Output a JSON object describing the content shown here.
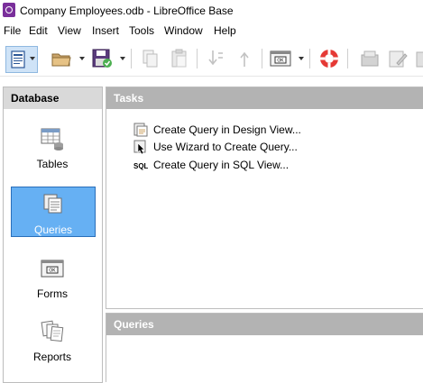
{
  "window": {
    "title": "Company Employees.odb - LibreOffice Base"
  },
  "menu": [
    "File",
    "Edit",
    "View",
    "Insert",
    "Tools",
    "Window",
    "Help"
  ],
  "toolbar": {
    "icons": [
      "new-document-icon",
      "open-folder-icon",
      "save-icon",
      "copy-icon",
      "paste-icon",
      "sort-ascending-icon",
      "sort-descending-icon",
      "form-control-icon",
      "help-lifebuoy-icon",
      "open-object-icon",
      "edit-object-icon",
      "delete-object-icon"
    ]
  },
  "sidebar": {
    "header": "Database",
    "items": [
      {
        "label": "Tables",
        "icon": "tables-icon",
        "selected": false
      },
      {
        "label": "Queries",
        "icon": "queries-icon",
        "selected": true
      },
      {
        "label": "Forms",
        "icon": "forms-icon",
        "selected": false
      },
      {
        "label": "Reports",
        "icon": "reports-icon",
        "selected": false
      }
    ]
  },
  "tasks": {
    "header": "Tasks",
    "items": [
      {
        "label": "Create Query in Design View...",
        "icon": "design-view-icon"
      },
      {
        "label": "Use Wizard to Create Query...",
        "icon": "wizard-icon"
      },
      {
        "label": "Create Query in SQL View...",
        "icon": "sql-icon",
        "icon_text": "SQL"
      }
    ]
  },
  "queries": {
    "header": "Queries"
  },
  "colors": {
    "selected_bg": "#66b0f3",
    "section_header": "#b3b3b3",
    "sidebar_header": "#d9d9d9",
    "app_icon": "#7a2f9b"
  }
}
